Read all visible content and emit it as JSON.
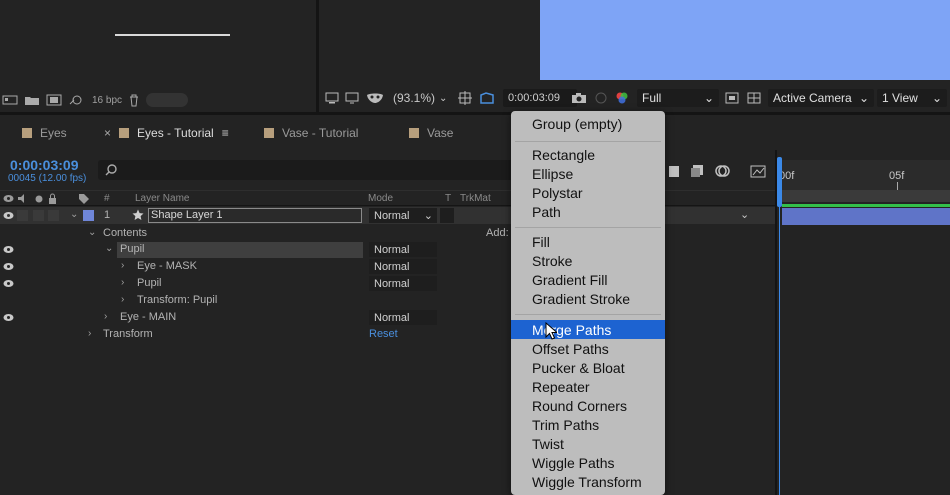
{
  "project_panel": {
    "bpc_label": "16 bpc"
  },
  "comp_toolbar": {
    "zoom": "(93.1%)",
    "timecode": "0:00:03:09",
    "resolution": "Full",
    "camera": "Active Camera",
    "views": "1 View"
  },
  "tabs": [
    {
      "label": "Eyes"
    },
    {
      "label": "Eyes - Tutorial"
    },
    {
      "label": "Vase - Tutorial"
    },
    {
      "label": "Vase"
    }
  ],
  "timeline": {
    "timecode": "0:00:03:09",
    "frames_fps": "00045 (12.00 fps)",
    "search_placeholder": "",
    "ruler": {
      "start": "00f",
      "mark": "05f"
    }
  },
  "layer_header": {
    "num": "#",
    "layer_name": "Layer Name",
    "mode": "Mode",
    "t": "T",
    "trkmat": "TrkMat"
  },
  "layers": {
    "shape_layer": {
      "num": "1",
      "name": "Shape Layer 1",
      "mode": "Normal"
    },
    "contents": {
      "label": "Contents",
      "add": "Add:"
    },
    "pupil_group": {
      "label": "Pupil",
      "mode": "Normal"
    },
    "eye_mask": {
      "label": "Eye - MASK",
      "mode": "Normal"
    },
    "pupil_path": {
      "label": "Pupil",
      "mode": "Normal"
    },
    "transform_pupil": {
      "label": "Transform: Pupil"
    },
    "eye_main": {
      "label": "Eye - MAIN",
      "mode": "Normal"
    },
    "transform": {
      "label": "Transform",
      "reset": "Reset"
    }
  },
  "menu": {
    "items": [
      "Group (empty)",
      "Rectangle",
      "Ellipse",
      "Polystar",
      "Path",
      "Fill",
      "Stroke",
      "Gradient Fill",
      "Gradient Stroke",
      "Merge Paths",
      "Offset Paths",
      "Pucker & Bloat",
      "Repeater",
      "Round Corners",
      "Trim Paths",
      "Twist",
      "Wiggle Paths",
      "Wiggle Transform"
    ],
    "highlighted": "Merge Paths"
  },
  "colors": {
    "accent": "#4a8fdd",
    "highlight": "#1d63d1",
    "comp_canvas": "#7ea4f6",
    "label_swatch": "#b79f7d",
    "layer_bar": "#5f74c8"
  }
}
